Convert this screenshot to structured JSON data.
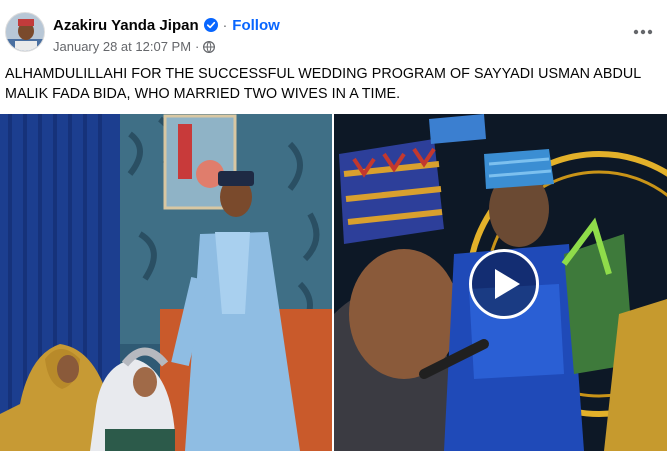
{
  "post": {
    "author": "Azakiru Yanda Jipan",
    "separator": "·",
    "follow_label": "Follow",
    "timestamp": "January 28 at 12:07 PM",
    "meta_dot": "·",
    "audience_icon": "globe-icon",
    "verified_icon": "verified-badge-icon",
    "more_icon": "more-options-icon",
    "caption": "ALHAMDULILLAHI FOR THE SUCCESSFUL WEDDING PROGRAM OF SAYYADI USMAN ABDUL MALIK FADA BIDA, WHO MARRIED TWO WIVES IN A TIME."
  },
  "media": {
    "items": [
      "wedding-photo",
      "wedding-video"
    ],
    "play_icon": "play-icon"
  },
  "colors": {
    "link_blue": "#0866ff",
    "secondary_text": "#65676b",
    "verified_blue": "#0866ff"
  }
}
